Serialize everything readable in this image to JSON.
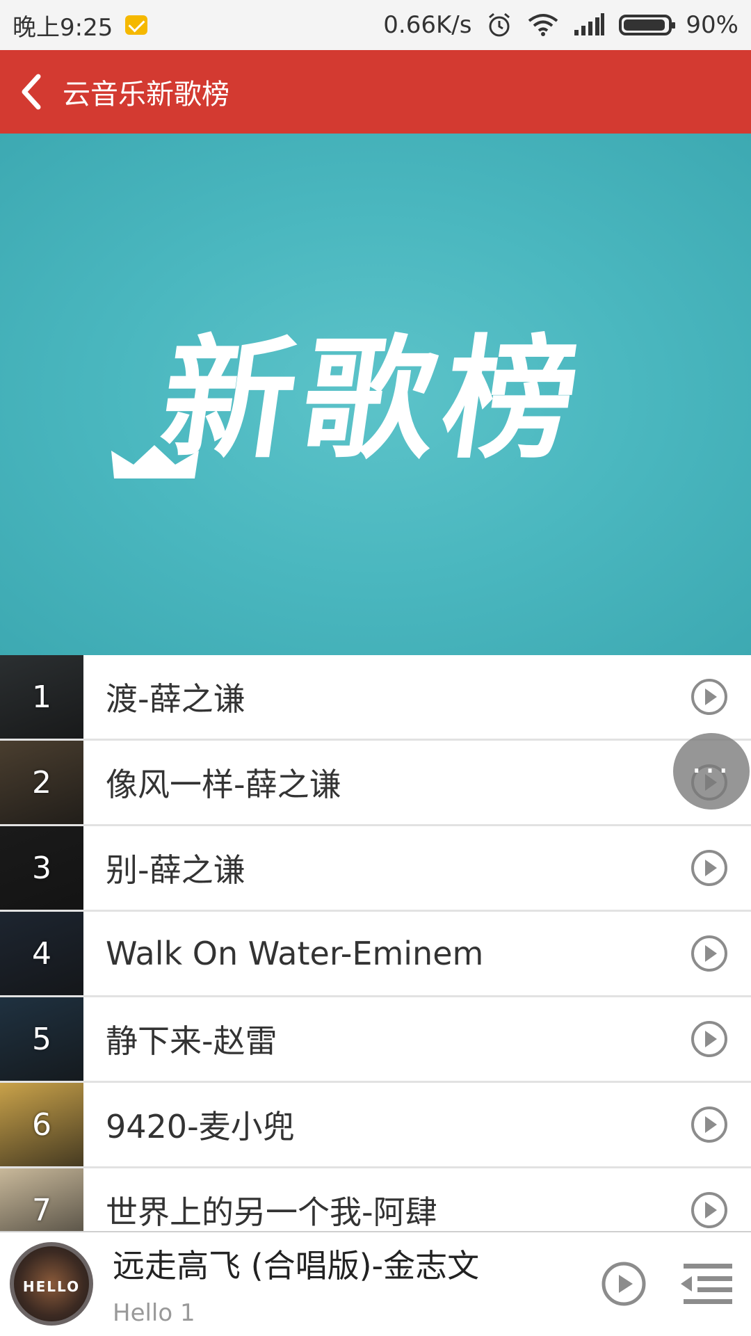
{
  "status_bar": {
    "time": "晚上9:25",
    "network_speed": "0.66K/s",
    "battery": "90%"
  },
  "header": {
    "title": "云音乐新歌榜"
  },
  "banner": {
    "text": "新歌榜",
    "colors": {
      "bg": "#4ab7bf",
      "text": "#ffffff"
    }
  },
  "songs": [
    {
      "rank": "1",
      "title": "渡-薛之谦",
      "thumb_color": "#2b2f31"
    },
    {
      "rank": "2",
      "title": "像风一样-薛之谦",
      "thumb_color": "#4a3e2f"
    },
    {
      "rank": "3",
      "title": "别-薛之谦",
      "thumb_color": "#1a1a1a"
    },
    {
      "rank": "4",
      "title": "Walk On Water-Eminem",
      "thumb_color": "#1d2530"
    },
    {
      "rank": "5",
      "title": "静下来-赵雷",
      "thumb_color": "#1f3140"
    },
    {
      "rank": "6",
      "title": "9420-麦小兜",
      "thumb_color": "#c9a24a"
    },
    {
      "rank": "7",
      "title": "世界上的另一个我-阿肆",
      "thumb_color": "#c8b89a"
    }
  ],
  "floating_button": {
    "label": "···"
  },
  "player": {
    "title": "远走高飞 (合唱版)-金志文",
    "subtitle": "Hello 1",
    "cover_label": "HELLO"
  },
  "colors": {
    "accent": "#d33a31",
    "icon_gray": "#8c8c8c"
  }
}
